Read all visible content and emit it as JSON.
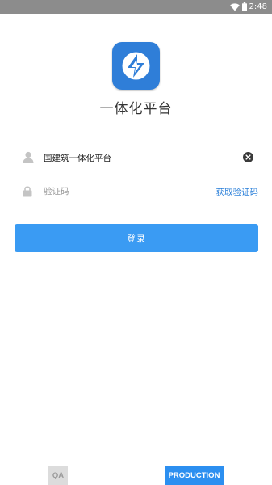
{
  "status_bar": {
    "time": "2:48",
    "icons": [
      "wifi-icon",
      "battery-icon"
    ]
  },
  "app": {
    "logo_icon": "app-logo-icon",
    "title": "一体化平台"
  },
  "form": {
    "username": {
      "icon": "user-icon",
      "value": "国建筑一体化平台",
      "clear_icon": "clear-icon"
    },
    "code": {
      "icon": "lock-icon",
      "placeholder": "验证码",
      "value": "",
      "get_code_label": "获取验证码"
    },
    "login_label": "登录"
  },
  "environment": {
    "qa_label": "QA",
    "production_label": "PRODUCTION",
    "selected": "PRODUCTION"
  },
  "colors": {
    "status_bar": "#8c8c8c",
    "accent": "#3a9bf3",
    "link": "#2a7fd9",
    "logo_bg": "#2f7ed8"
  }
}
